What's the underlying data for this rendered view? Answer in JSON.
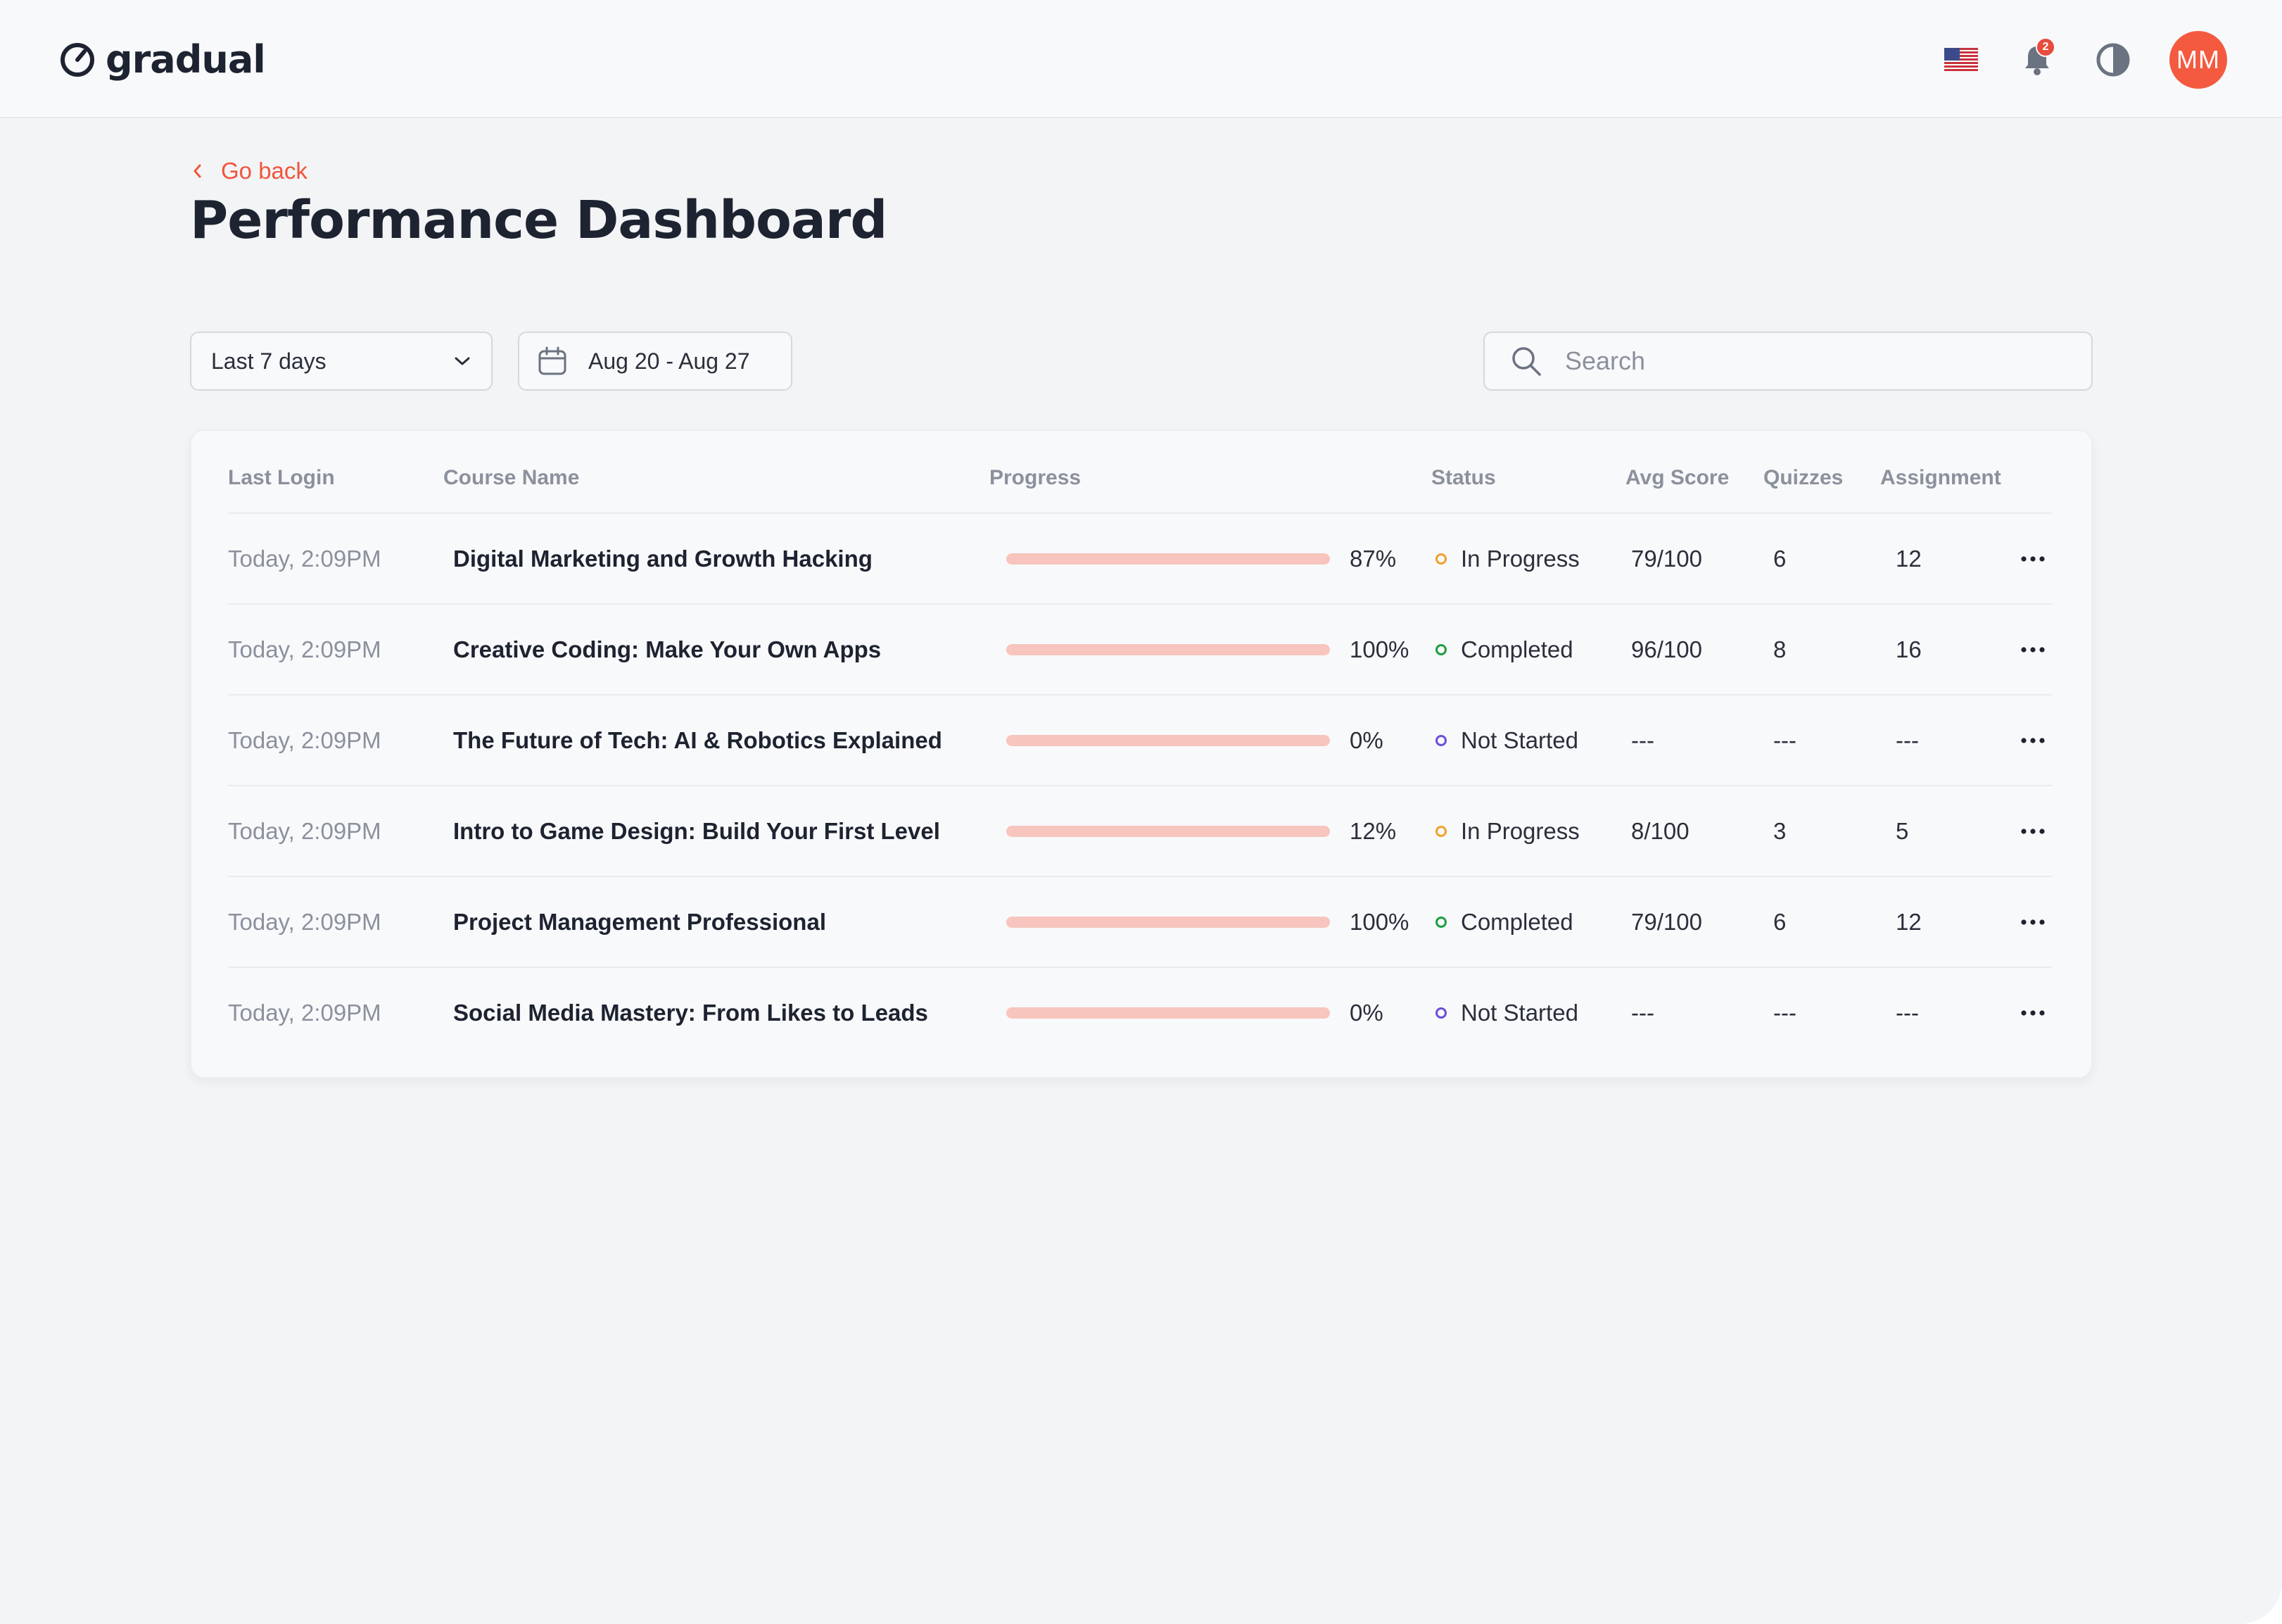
{
  "brand": {
    "logo_text": "gradual"
  },
  "topbar": {
    "language_icon": "us-flag-icon",
    "notifications_count": "2",
    "theme_icon": "contrast-icon",
    "avatar_initials": "MM",
    "accent_color": "#f45a3f"
  },
  "header": {
    "back_label": "Go back",
    "title": "Performance Dashboard"
  },
  "filters": {
    "range_value": "Last 7 days",
    "date_range": "Aug 20 - Aug 27",
    "search_placeholder": "Search",
    "search_value": ""
  },
  "table": {
    "columns": [
      "Last Login",
      "Course Name",
      "Progress",
      "Status",
      "Avg Score",
      "Quizzes",
      "Assignment"
    ],
    "rows": [
      {
        "last_login": "Today, 2:09PM",
        "course": "Digital Marketing and Growth Hacking",
        "progress": 87,
        "progress_label": "87%",
        "status": "In Progress",
        "status_color": "#f0a12c",
        "avg_score": "79/100",
        "quizzes": "6",
        "assignment": "12"
      },
      {
        "last_login": "Today, 2:09PM",
        "course": "Creative Coding: Make Your Own Apps",
        "progress": 100,
        "progress_label": "100%",
        "status": "Completed",
        "status_color": "#1e9e3e",
        "avg_score": "96/100",
        "quizzes": "8",
        "assignment": "16"
      },
      {
        "last_login": "Today, 2:09PM",
        "course": "The Future of Tech: AI & Robotics Explained",
        "progress": 0,
        "progress_label": "0%",
        "status": "Not Started",
        "status_color": "#6a4fd8",
        "avg_score": "---",
        "quizzes": "---",
        "assignment": "---"
      },
      {
        "last_login": "Today, 2:09PM",
        "course": "Intro to Game Design: Build Your First Level",
        "progress": 12,
        "progress_label": "12%",
        "status": "In Progress",
        "status_color": "#f0a12c",
        "avg_score": "8/100",
        "quizzes": "3",
        "assignment": "5"
      },
      {
        "last_login": "Today, 2:09PM",
        "course": "Project Management Professional",
        "progress": 100,
        "progress_label": "100%",
        "status": "Completed",
        "status_color": "#1e9e3e",
        "avg_score": "79/100",
        "quizzes": "6",
        "assignment": "12"
      },
      {
        "last_login": "Today, 2:09PM",
        "course": "Social Media Mastery: From Likes to Leads",
        "progress": 0,
        "progress_label": "0%",
        "status": "Not Started",
        "status_color": "#6a4fd8",
        "avg_score": "---",
        "quizzes": "---",
        "assignment": "---"
      }
    ]
  }
}
